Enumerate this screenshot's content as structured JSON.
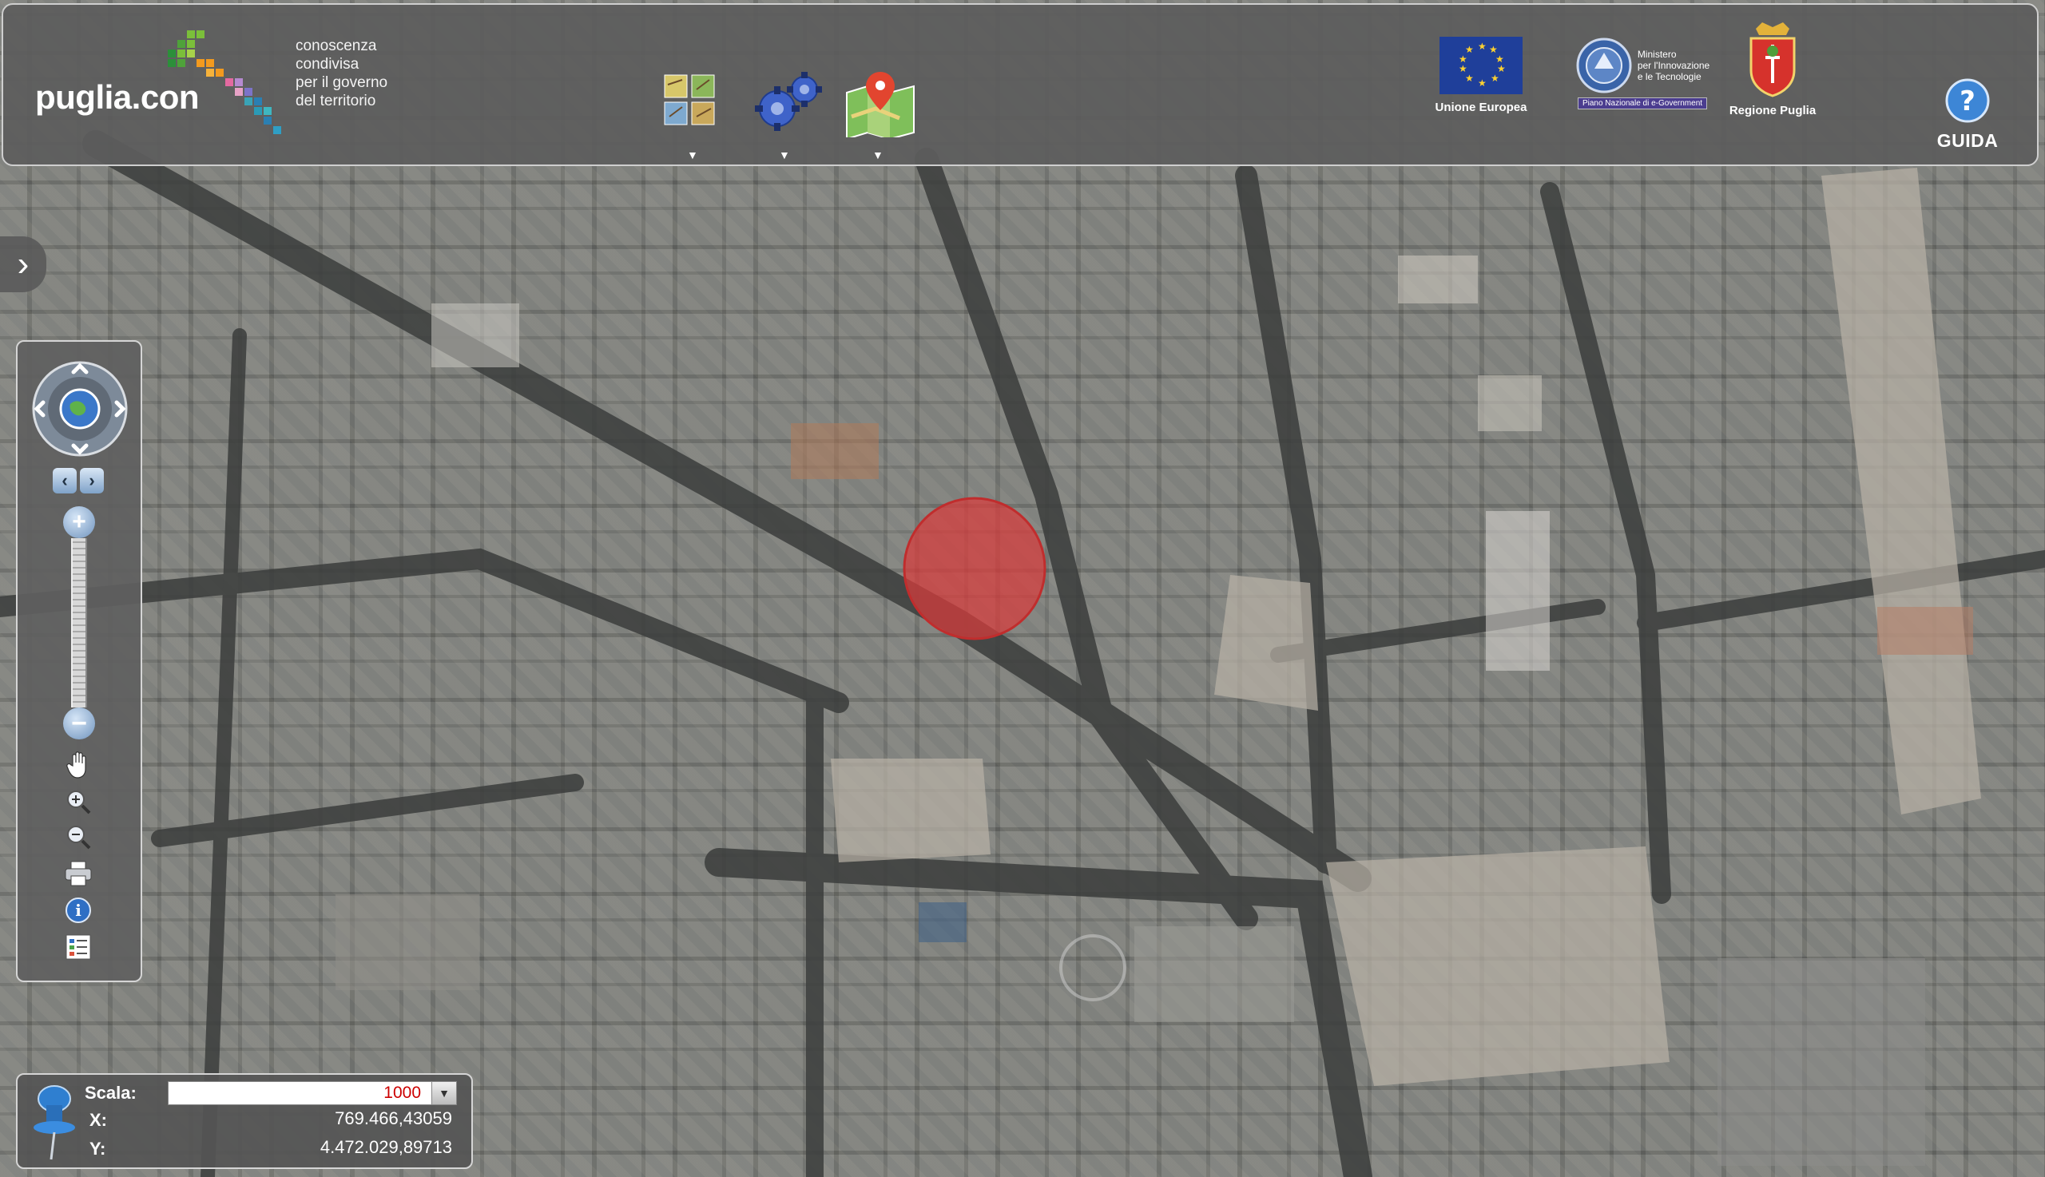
{
  "header": {
    "logo": {
      "name": "puglia.con",
      "tagline": [
        "conoscenza",
        "condivisa",
        "per il governo",
        "del territorio"
      ]
    },
    "tools": [
      {
        "name": "layers",
        "icon": "layers-icon"
      },
      {
        "name": "tools",
        "icon": "gears-icon"
      },
      {
        "name": "maps",
        "icon": "map-pin-icon"
      }
    ],
    "partners": {
      "eu": "Unione Europea",
      "ministry": [
        "Ministero",
        "per l'Innovazione",
        "e le Tecnologie"
      ],
      "ministry_plan": "Piano Nazionale di e-Government",
      "region": "Regione Puglia"
    },
    "help_label": "GUIDA"
  },
  "nav": {
    "history_back": "‹",
    "history_forward": "›",
    "zoom_in": "+",
    "zoom_out": "−"
  },
  "coords": {
    "scala_label": "Scala:",
    "scala_value": "1000",
    "x_label": "X:",
    "x_value": "769.466,43059",
    "y_label": "Y:",
    "y_value": "4.472.029,89713"
  },
  "colors": {
    "marker": "#d93b3b",
    "panel": "#5c5c5c",
    "accent": "#4f7fb8"
  }
}
